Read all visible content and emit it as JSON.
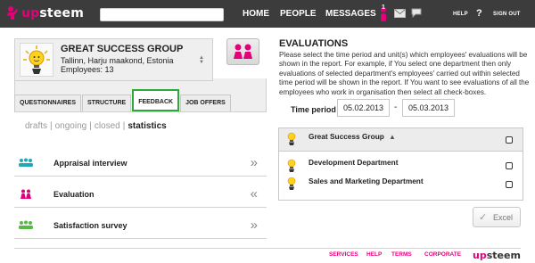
{
  "brand": {
    "logo_up": "up",
    "logo_rest": "steem",
    "accent": "#e4007a",
    "active_tab_border": "#2ea83a"
  },
  "topbar": {
    "search": {
      "value": "",
      "placeholder": ""
    },
    "nav": [
      "HOME",
      "PEOPLE",
      "MESSAGES"
    ],
    "notification_count": "1",
    "help": "HELP",
    "help_icon": "?",
    "signout": "SIGN OUT"
  },
  "group": {
    "name": "GREAT SUCCESS GROUP",
    "location": "Tallinn, Harju maakond, Estonia",
    "employees": "Employees: 13"
  },
  "tabs": [
    "QUESTIONNAIRES",
    "STRUCTURE",
    "FEEDBACK",
    "JOB OFFERS"
  ],
  "active_tab": "FEEDBACK",
  "subnav": {
    "drafts": "drafts",
    "ongoing": "ongoing",
    "closed": "closed",
    "statistics": "statistics",
    "separator": "|"
  },
  "feedback_items": [
    {
      "label": "Appraisal interview",
      "arrow": "»",
      "icon": "people-group-teal-icon"
    },
    {
      "label": "Evaluation",
      "arrow": "«",
      "icon": "people-pair-pink-icon"
    },
    {
      "label": "Satisfaction survey",
      "arrow": "»",
      "icon": "people-group-green-icon"
    }
  ],
  "evaluations": {
    "title": "EVALUATIONS",
    "description": "Please select the time period and unit(s) which employees' evaluations will be shown in the report. For example, if You select one department then only evaluations of selected department's employees' carried out within selected time period will be shown in the report. If You want to see evaluations of all the employees who work in organisation then select all check-boxes.",
    "time_period_label": "Time period",
    "date_from": "05.02.2013",
    "date_to": "05.03.2013",
    "dash": "-",
    "units": [
      {
        "name": "Great Success Group",
        "checked": false,
        "expand": "▲"
      },
      {
        "name": "Development Department",
        "checked": false
      },
      {
        "name": "Sales and Marketing Department",
        "checked": false
      }
    ],
    "excel_label": "Excel",
    "excel_icon": "✓"
  },
  "footer": {
    "links": [
      "SERVICES",
      "HELP",
      "TERMS",
      "CORPORATE"
    ],
    "logo_up": "up",
    "logo_rest": "steem"
  }
}
